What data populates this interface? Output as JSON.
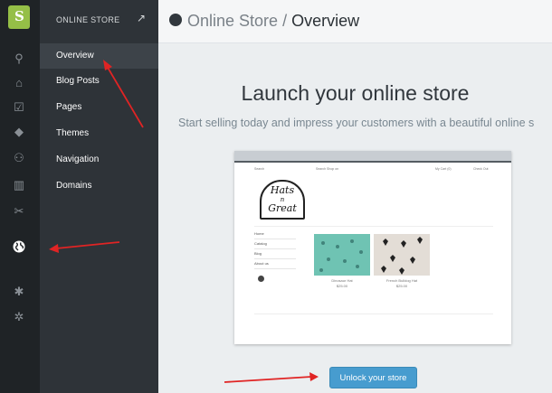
{
  "icon_bar": {
    "items": [
      {
        "icon": "shopify-logo-icon",
        "glyph": "S"
      },
      {
        "icon": "search-icon",
        "glyph": "⚲"
      },
      {
        "icon": "home-icon",
        "glyph": "⌂"
      },
      {
        "icon": "orders-icon",
        "glyph": "☑"
      },
      {
        "icon": "products-icon",
        "glyph": "◆"
      },
      {
        "icon": "customers-icon",
        "glyph": "⚇"
      },
      {
        "icon": "reports-icon",
        "glyph": "▥"
      },
      {
        "icon": "discounts-icon",
        "glyph": "✂"
      },
      {
        "icon": "online-store-icon",
        "glyph": "🌐"
      },
      {
        "icon": "apps-icon",
        "glyph": "✱"
      },
      {
        "icon": "settings-icon",
        "glyph": "✲"
      }
    ]
  },
  "menu": {
    "title": "ONLINE STORE",
    "external_icon": "↗",
    "items": [
      {
        "label": "Overview"
      },
      {
        "label": "Blog Posts"
      },
      {
        "label": "Pages"
      },
      {
        "label": "Themes"
      },
      {
        "label": "Navigation"
      },
      {
        "label": "Domains"
      }
    ]
  },
  "header": {
    "section": "Online Store",
    "separator": " / ",
    "page": "Overview"
  },
  "main": {
    "headline": "Launch your online store",
    "subtitle": "Start selling today and impress your customers with a beautiful online s",
    "button_label": "Unlock your store"
  },
  "preview": {
    "nav_search": "Search",
    "nav_links": "Search    Shop on",
    "nav_cart": "My Cart (0)",
    "nav_checkout": "Check Out",
    "logo_lines": [
      "Hats",
      "n",
      "Great"
    ],
    "sidebar": [
      "Home",
      "Catalog",
      "Blog",
      "About us"
    ],
    "products": [
      {
        "name": "Dinosaur Hat",
        "price": "$25.00"
      },
      {
        "name": "French Bulldog Hat",
        "price": "$25.00"
      }
    ]
  },
  "colors": {
    "icon_bar": "#1f2326",
    "menu": "#2e3338",
    "active_item": "#3d4349",
    "button": "#479ccf",
    "annotation_arrow": "#e02424"
  }
}
